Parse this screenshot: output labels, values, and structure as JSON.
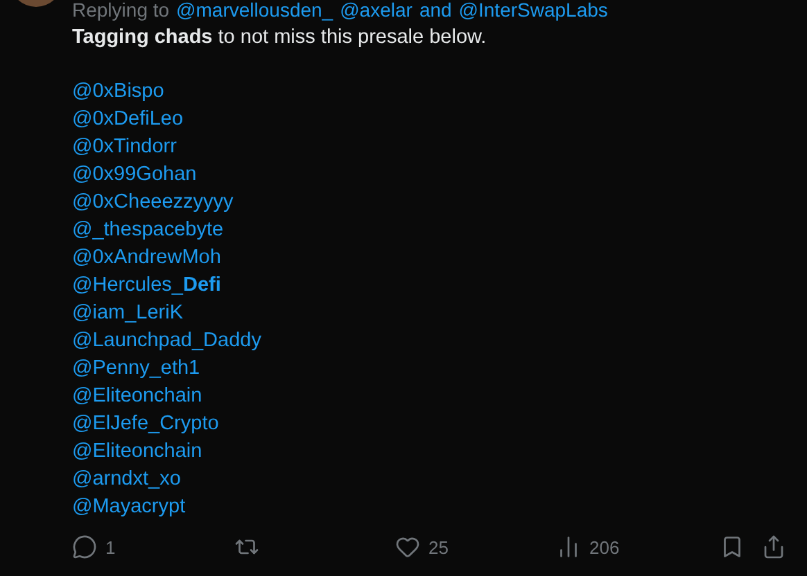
{
  "reply_to": [
    {
      "kind": "plain",
      "text": "Replying to"
    },
    {
      "kind": "link",
      "text": "@marvellousden_"
    },
    {
      "kind": "link",
      "text": "@axelar"
    },
    {
      "kind": "link",
      "text": "and"
    },
    {
      "kind": "link",
      "text": "@InterSwapLabs"
    }
  ],
  "intro": "**Tagging chads** to not miss this presale below.",
  "mentions": [
    "@0xBispo",
    "@0xDefiLeo",
    "@0xTindorr",
    "@0x99Gohan",
    "@0xCheeezzyyyy",
    "@_thespacebyte",
    "@0xAndrewMoh",
    "@Hercules_**Defi**",
    "@iam_LeriK",
    "@Launchpad_Daddy",
    "@Penny_eth1",
    "@Eliteonchain",
    "@ElJefe_Crypto",
    "@Eliteonchain",
    "@arndxt_xo",
    "@Mayacrypt"
  ],
  "actions": [
    {
      "kind": "reply",
      "count": "1"
    },
    {
      "kind": "repost"
    },
    {
      "kind": "like",
      "count": "25"
    },
    {
      "kind": "views",
      "count": "206"
    },
    {
      "kind": "bookmark"
    },
    {
      "kind": "share"
    }
  ]
}
